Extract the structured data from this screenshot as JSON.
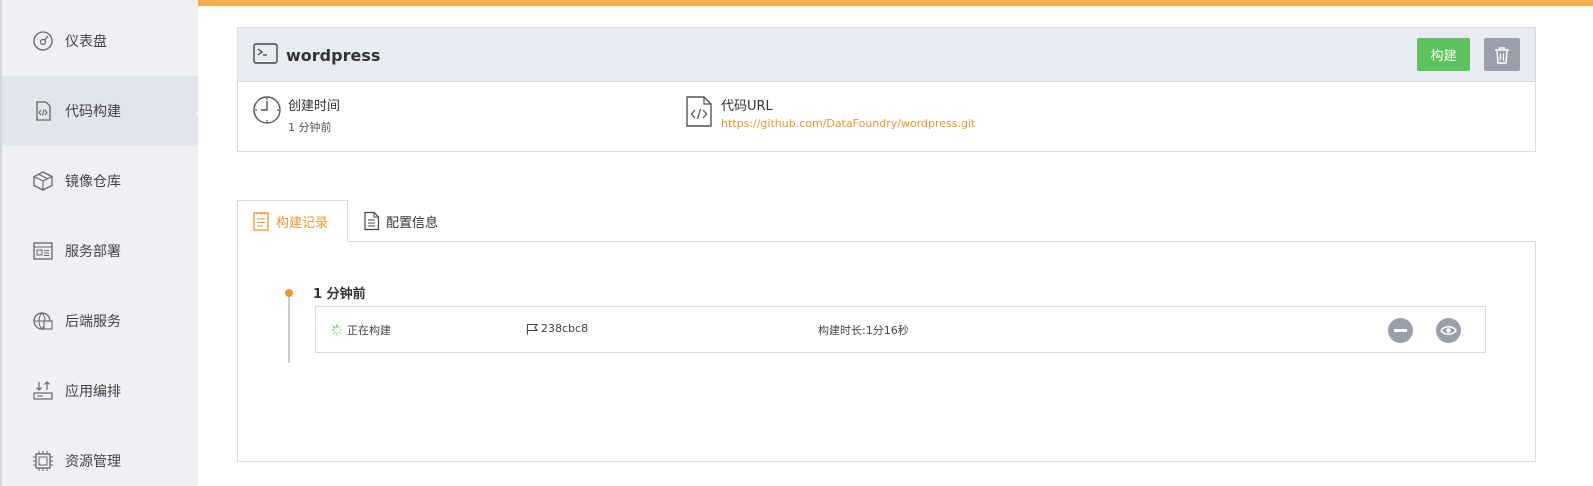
{
  "colors": {
    "accent": "#f7ab4a",
    "link": "#f0952f",
    "build_button": "#5cc25c",
    "icon_button": "#9aa0ab",
    "sidebar_bg": "#eef0f4"
  },
  "sidebar": {
    "items": [
      {
        "label": "仪表盘",
        "icon": "dashboard-icon"
      },
      {
        "label": "代码构建",
        "icon": "code-file-icon",
        "active": true
      },
      {
        "label": "镜像仓库",
        "icon": "box-icon"
      },
      {
        "label": "服务部署",
        "icon": "browser-window-icon"
      },
      {
        "label": "后端服务",
        "icon": "globe-server-icon"
      },
      {
        "label": "应用编排",
        "icon": "upload-tray-icon"
      },
      {
        "label": "资源管理",
        "icon": "chip-icon"
      }
    ]
  },
  "project": {
    "name": "wordpress",
    "build_label": "构建",
    "delete_icon": "trash-icon",
    "created_label": "创建时间",
    "created_value": "1 分钟前",
    "url_label": "代码URL",
    "url_value": "https://github.com/DataFoundry/wordpress.git"
  },
  "tabs": [
    {
      "label": "构建记录",
      "icon": "notepad-icon",
      "active": true
    },
    {
      "label": "配置信息",
      "icon": "document-icon"
    }
  ],
  "builds": {
    "group_title": "1 分钟前",
    "records": [
      {
        "status": "正在构建",
        "commit": "238cbc8",
        "duration": "构建时长:1分16秒",
        "actions": [
          "stop-icon",
          "eye-icon"
        ]
      }
    ]
  }
}
